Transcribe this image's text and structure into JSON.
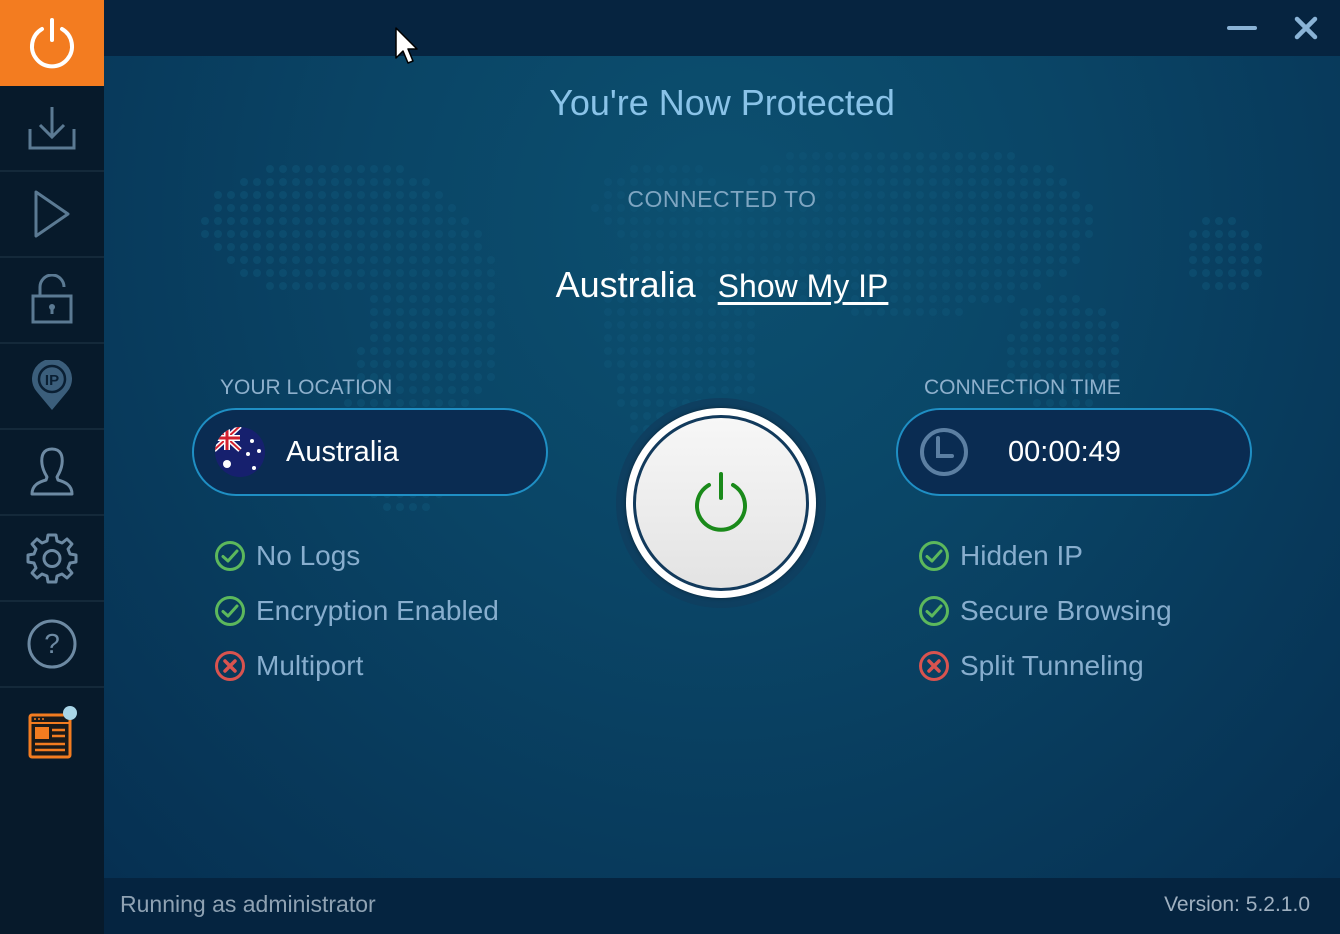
{
  "sidebar": {
    "items": [
      {
        "name": "connect",
        "icon": "power-icon",
        "active": true
      },
      {
        "name": "download",
        "icon": "download-icon"
      },
      {
        "name": "play",
        "icon": "play-icon"
      },
      {
        "name": "lock",
        "icon": "lock-icon"
      },
      {
        "name": "ip",
        "icon": "ip-location-icon",
        "icon_text": "IP"
      },
      {
        "name": "account",
        "icon": "user-icon"
      },
      {
        "name": "settings",
        "icon": "gear-icon"
      },
      {
        "name": "help",
        "icon": "help-icon",
        "icon_text": "?"
      },
      {
        "name": "news",
        "icon": "news-icon",
        "has_notification": true
      }
    ],
    "accent_color": "#f37c20"
  },
  "window": {
    "minimize_icon": "minimize-icon",
    "close_icon": "close-icon"
  },
  "main": {
    "title": "You're Now Protected",
    "connected_to_label": "CONNECTED TO",
    "connected_country": "Australia",
    "show_ip_link": "Show My IP",
    "location": {
      "label": "YOUR LOCATION",
      "value": "Australia",
      "flag_icon": "australia-flag-icon"
    },
    "connection_time": {
      "label": "CONNECTION TIME",
      "value": "00:00:49",
      "icon": "clock-icon"
    },
    "left_features": [
      {
        "label": "No Logs",
        "status": "enabled"
      },
      {
        "label": "Encryption Enabled",
        "status": "enabled"
      },
      {
        "label": "Multiport",
        "status": "disabled"
      }
    ],
    "right_features": [
      {
        "label": "Hidden IP",
        "status": "enabled"
      },
      {
        "label": "Secure Browsing",
        "status": "enabled"
      },
      {
        "label": "Split Tunneling",
        "status": "disabled"
      }
    ],
    "power_button_color": "#1a8a1a",
    "enabled_color": "#5cb85c",
    "disabled_color": "#d9534f"
  },
  "footer": {
    "status": "Running as administrator",
    "version": "Version:  5.2.1.0"
  }
}
